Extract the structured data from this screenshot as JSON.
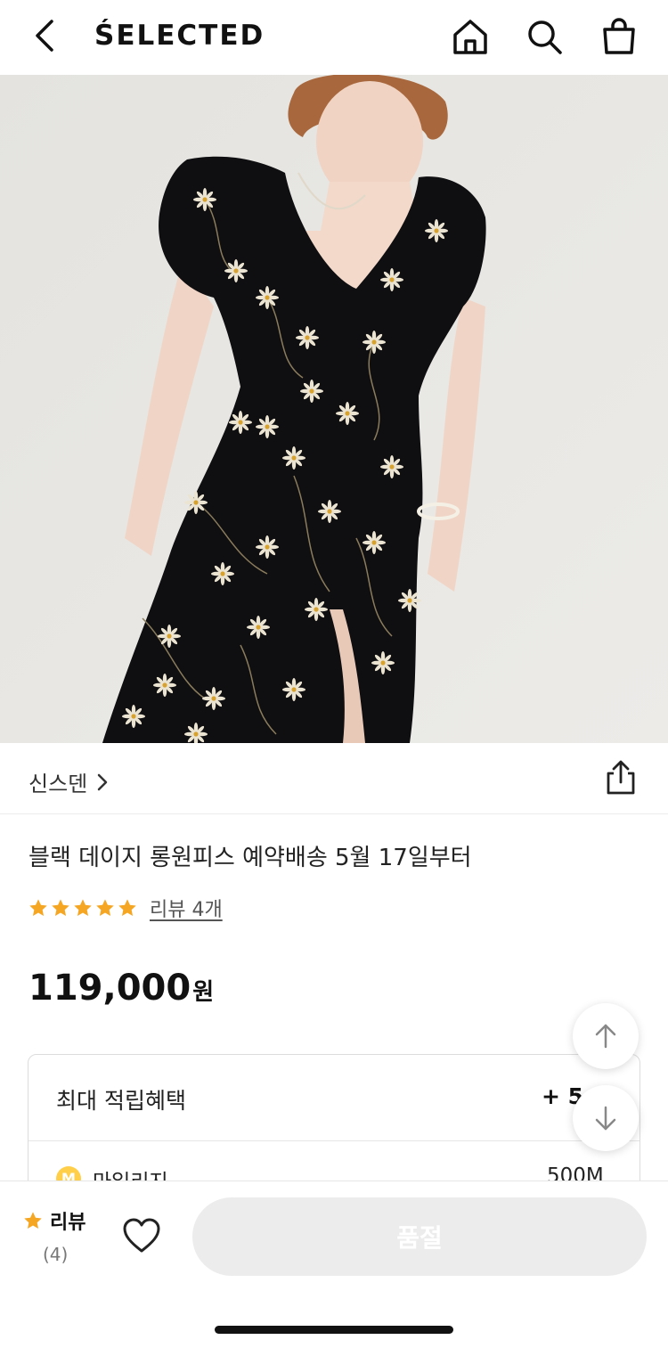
{
  "header": {
    "back_icon": "chevron-left-icon",
    "brand": "ŚELECTED",
    "icons": [
      "home-icon",
      "search-icon",
      "shopping-bag-icon"
    ]
  },
  "product_image": {
    "alt": "product-photo"
  },
  "brand_row": {
    "brand_name": "신스덴",
    "chevron_icon": "chevron-right-icon",
    "share_icon": "share-icon"
  },
  "product": {
    "title": "블랙 데이지 롱원피스 예약배송 5월 17일부터",
    "rating_stars": 5,
    "review_link": "리뷰 4개",
    "price": "119,000",
    "price_unit": "원"
  },
  "benefit": {
    "title": "최대 적립혜택",
    "value": "+ 5",
    "mileage_badge": "M",
    "mileage_label": "마일리지",
    "mileage_value": "500M"
  },
  "scroll_buttons": {
    "up_icon": "arrow-up-icon",
    "down_icon": "arrow-down-icon"
  },
  "bottom_bar": {
    "review_label": "리뷰",
    "review_count": "(4)",
    "heart_icon": "heart-icon",
    "cta_label": "품절"
  },
  "colors": {
    "star": "#f5a623",
    "cta_bg": "#ececec",
    "mileage_badge": "#ffcf4a"
  }
}
